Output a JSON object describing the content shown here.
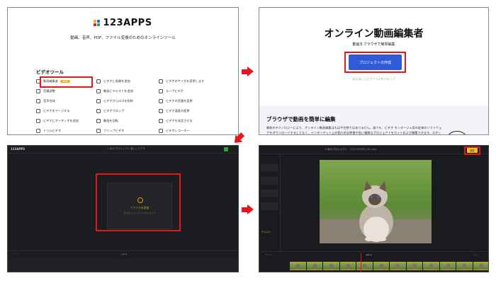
{
  "step1": {
    "logo": "123APPS",
    "tagline": "動画、音声、PDF、ファイル変換のためのオンラインツール",
    "section_title": "ビデオツール",
    "new_badge": "NEW",
    "tools": [
      {
        "label": "動画編集者",
        "icon": "film-icon"
      },
      {
        "label": "ビデオに画像を追加",
        "icon": "image-icon"
      },
      {
        "label": "ビデオのサイズを変更します",
        "icon": "resize-icon"
      },
      {
        "label": "音量調整",
        "icon": "volume-icon"
      },
      {
        "label": "動画にテキストを追加",
        "icon": "text-icon"
      },
      {
        "label": "ループビデオ",
        "icon": "loop-icon"
      },
      {
        "label": "音声合成",
        "icon": "merge-audio-icon"
      },
      {
        "label": "ビデオからロゴを削除",
        "icon": "eraser-icon"
      },
      {
        "label": "ビデオの音量を変更",
        "icon": "speaker-icon"
      },
      {
        "label": "ビデオをマージする",
        "icon": "merge-icon"
      },
      {
        "label": "ビデオクロップ",
        "icon": "crop-icon"
      },
      {
        "label": "ビデオ速度の変更",
        "icon": "speed-icon"
      },
      {
        "label": "ビデオにオーディオを追加",
        "icon": "music-icon"
      },
      {
        "label": "動画を回転",
        "icon": "rotate-icon"
      },
      {
        "label": "ビデオを安定させる",
        "icon": "stabilize-icon"
      },
      {
        "label": "トリムビデオ",
        "icon": "scissors-icon"
      },
      {
        "label": "フリップビデオ",
        "icon": "flip-icon"
      },
      {
        "label": "ビデオレコーダー",
        "icon": "record-icon"
      }
    ]
  },
  "step2": {
    "title": "オンライン動画編集者",
    "subtitle": "動画をブラウザで簡単編集",
    "button": "プロジェクトの作成",
    "drop_hint": "またはここにファイルをドロップ",
    "section_title": "ブラウザで動画を簡単に編集",
    "body": "最新のテクノロジーにより、オンライン動画編集はもはや空想ではありません。誰でも、ビデオ モンタージュ用の従来のソフトウェアをダウンロードすることなく、インターネット上の個人的な映像や長い複雑なプロジェクトをカットおよび編集できます。エディターは軽量し、初心者からプロまで、ほと"
  },
  "step3": {
    "logo": "123APPS",
    "tabs": "< 私のプロジェクト   新しいビデオ",
    "add_file": "ファイルを追加",
    "drop_hint": "またはここにファイルをドロップ"
  },
  "step4": {
    "back": "< 私のプロジェクト",
    "filename": "1024-03490_cat.mp4",
    "save": "保存",
    "side_label": "テキスト"
  },
  "colors": {
    "highlight": "#e8141b",
    "primary_button": "#2f5bd6",
    "accent_yellow": "#e6c619",
    "editor_bg": "#1c1d20"
  }
}
